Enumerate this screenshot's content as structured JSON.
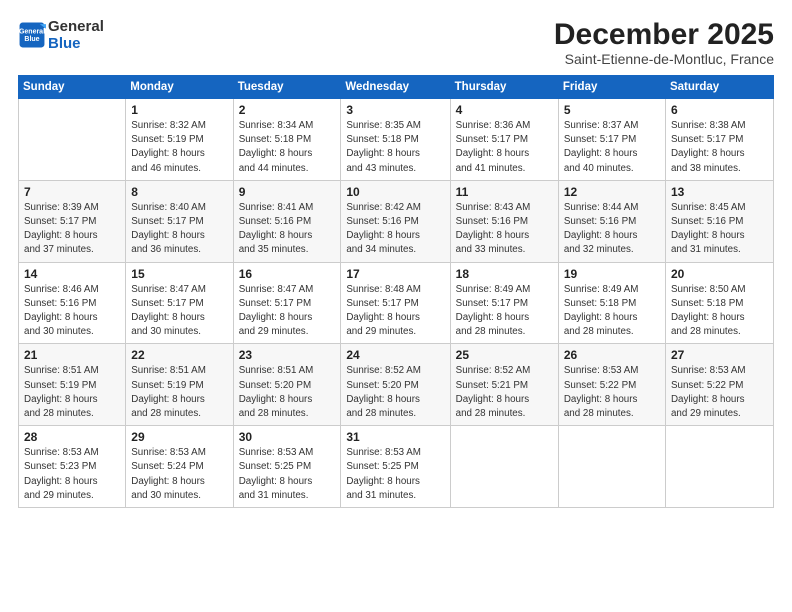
{
  "logo": {
    "line1": "General",
    "line2": "Blue"
  },
  "title": "December 2025",
  "subtitle": "Saint-Etienne-de-Montluc, France",
  "weekdays": [
    "Sunday",
    "Monday",
    "Tuesday",
    "Wednesday",
    "Thursday",
    "Friday",
    "Saturday"
  ],
  "weeks": [
    [
      {
        "day": "",
        "info": ""
      },
      {
        "day": "1",
        "info": "Sunrise: 8:32 AM\nSunset: 5:19 PM\nDaylight: 8 hours\nand 46 minutes."
      },
      {
        "day": "2",
        "info": "Sunrise: 8:34 AM\nSunset: 5:18 PM\nDaylight: 8 hours\nand 44 minutes."
      },
      {
        "day": "3",
        "info": "Sunrise: 8:35 AM\nSunset: 5:18 PM\nDaylight: 8 hours\nand 43 minutes."
      },
      {
        "day": "4",
        "info": "Sunrise: 8:36 AM\nSunset: 5:17 PM\nDaylight: 8 hours\nand 41 minutes."
      },
      {
        "day": "5",
        "info": "Sunrise: 8:37 AM\nSunset: 5:17 PM\nDaylight: 8 hours\nand 40 minutes."
      },
      {
        "day": "6",
        "info": "Sunrise: 8:38 AM\nSunset: 5:17 PM\nDaylight: 8 hours\nand 38 minutes."
      }
    ],
    [
      {
        "day": "7",
        "info": "Sunrise: 8:39 AM\nSunset: 5:17 PM\nDaylight: 8 hours\nand 37 minutes."
      },
      {
        "day": "8",
        "info": "Sunrise: 8:40 AM\nSunset: 5:17 PM\nDaylight: 8 hours\nand 36 minutes."
      },
      {
        "day": "9",
        "info": "Sunrise: 8:41 AM\nSunset: 5:16 PM\nDaylight: 8 hours\nand 35 minutes."
      },
      {
        "day": "10",
        "info": "Sunrise: 8:42 AM\nSunset: 5:16 PM\nDaylight: 8 hours\nand 34 minutes."
      },
      {
        "day": "11",
        "info": "Sunrise: 8:43 AM\nSunset: 5:16 PM\nDaylight: 8 hours\nand 33 minutes."
      },
      {
        "day": "12",
        "info": "Sunrise: 8:44 AM\nSunset: 5:16 PM\nDaylight: 8 hours\nand 32 minutes."
      },
      {
        "day": "13",
        "info": "Sunrise: 8:45 AM\nSunset: 5:16 PM\nDaylight: 8 hours\nand 31 minutes."
      }
    ],
    [
      {
        "day": "14",
        "info": "Sunrise: 8:46 AM\nSunset: 5:16 PM\nDaylight: 8 hours\nand 30 minutes."
      },
      {
        "day": "15",
        "info": "Sunrise: 8:47 AM\nSunset: 5:17 PM\nDaylight: 8 hours\nand 30 minutes."
      },
      {
        "day": "16",
        "info": "Sunrise: 8:47 AM\nSunset: 5:17 PM\nDaylight: 8 hours\nand 29 minutes."
      },
      {
        "day": "17",
        "info": "Sunrise: 8:48 AM\nSunset: 5:17 PM\nDaylight: 8 hours\nand 29 minutes."
      },
      {
        "day": "18",
        "info": "Sunrise: 8:49 AM\nSunset: 5:17 PM\nDaylight: 8 hours\nand 28 minutes."
      },
      {
        "day": "19",
        "info": "Sunrise: 8:49 AM\nSunset: 5:18 PM\nDaylight: 8 hours\nand 28 minutes."
      },
      {
        "day": "20",
        "info": "Sunrise: 8:50 AM\nSunset: 5:18 PM\nDaylight: 8 hours\nand 28 minutes."
      }
    ],
    [
      {
        "day": "21",
        "info": "Sunrise: 8:51 AM\nSunset: 5:19 PM\nDaylight: 8 hours\nand 28 minutes."
      },
      {
        "day": "22",
        "info": "Sunrise: 8:51 AM\nSunset: 5:19 PM\nDaylight: 8 hours\nand 28 minutes."
      },
      {
        "day": "23",
        "info": "Sunrise: 8:51 AM\nSunset: 5:20 PM\nDaylight: 8 hours\nand 28 minutes."
      },
      {
        "day": "24",
        "info": "Sunrise: 8:52 AM\nSunset: 5:20 PM\nDaylight: 8 hours\nand 28 minutes."
      },
      {
        "day": "25",
        "info": "Sunrise: 8:52 AM\nSunset: 5:21 PM\nDaylight: 8 hours\nand 28 minutes."
      },
      {
        "day": "26",
        "info": "Sunrise: 8:53 AM\nSunset: 5:22 PM\nDaylight: 8 hours\nand 28 minutes."
      },
      {
        "day": "27",
        "info": "Sunrise: 8:53 AM\nSunset: 5:22 PM\nDaylight: 8 hours\nand 29 minutes."
      }
    ],
    [
      {
        "day": "28",
        "info": "Sunrise: 8:53 AM\nSunset: 5:23 PM\nDaylight: 8 hours\nand 29 minutes."
      },
      {
        "day": "29",
        "info": "Sunrise: 8:53 AM\nSunset: 5:24 PM\nDaylight: 8 hours\nand 30 minutes."
      },
      {
        "day": "30",
        "info": "Sunrise: 8:53 AM\nSunset: 5:25 PM\nDaylight: 8 hours\nand 31 minutes."
      },
      {
        "day": "31",
        "info": "Sunrise: 8:53 AM\nSunset: 5:25 PM\nDaylight: 8 hours\nand 31 minutes."
      },
      {
        "day": "",
        "info": ""
      },
      {
        "day": "",
        "info": ""
      },
      {
        "day": "",
        "info": ""
      }
    ]
  ]
}
